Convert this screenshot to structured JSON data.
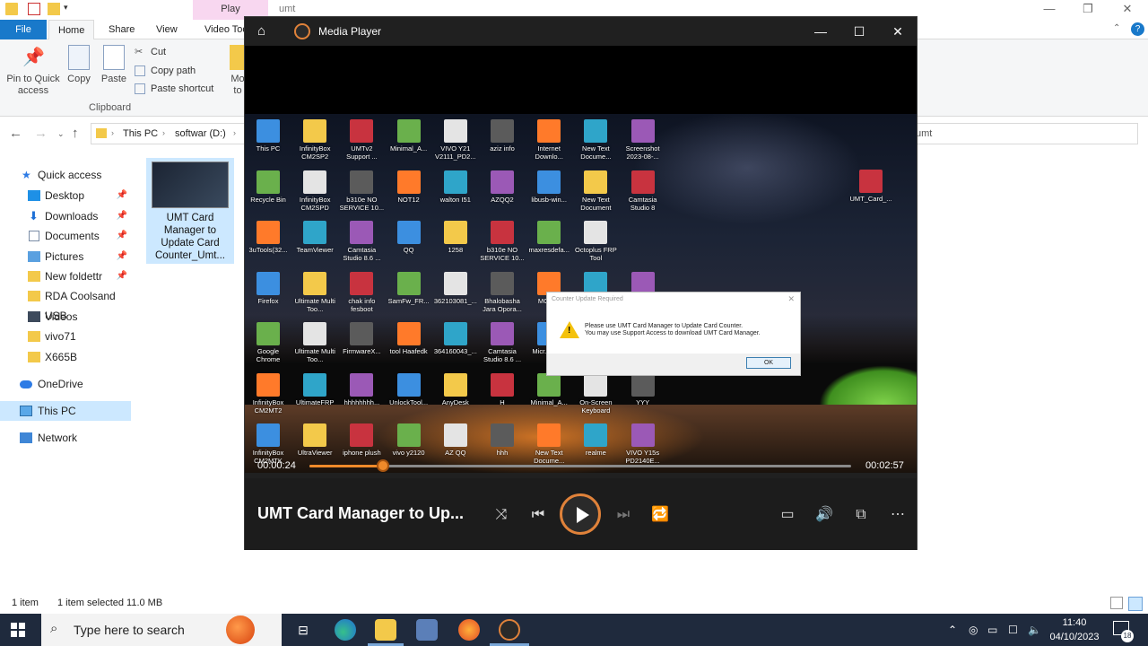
{
  "explorer": {
    "window_title": "umt",
    "context_tab": "Play",
    "tabs": [
      "File",
      "Home",
      "Share",
      "View",
      "Video Tools"
    ],
    "ribbon": {
      "pin_label": "Pin to Quick access",
      "copy_label": "Copy",
      "paste_label": "Paste",
      "cut_label": "Cut",
      "copy_path_label": "Copy path",
      "paste_shortcut_label": "Paste shortcut",
      "move_label": "Mo\nto",
      "group_clipboard": "Clipboard"
    },
    "breadcrumb": [
      "This PC",
      "softwar (D:)"
    ],
    "search_text": "umt",
    "nav": {
      "quick_access": "Quick access",
      "items": [
        {
          "label": "Desktop",
          "pinned": true
        },
        {
          "label": "Downloads",
          "pinned": true
        },
        {
          "label": "Documents",
          "pinned": true
        },
        {
          "label": "Pictures",
          "pinned": true
        },
        {
          "label": "New foldettr",
          "pinned": true
        },
        {
          "label": "RDA Coolsand USB",
          "pinned": false
        },
        {
          "label": "Videos",
          "pinned": false
        },
        {
          "label": "vivo71",
          "pinned": false
        },
        {
          "label": "X665B",
          "pinned": false
        }
      ],
      "onedrive": "OneDrive",
      "this_pc": "This PC",
      "network": "Network"
    },
    "file": {
      "name": "UMT Card Manager to Update Card Counter_Umt..."
    },
    "status": {
      "count": "1 item",
      "selected": "1 item selected  11.0 MB"
    }
  },
  "player": {
    "title": "Media Player",
    "current_time": "00:00:24",
    "total_time": "00:02:57",
    "progress": 0.135,
    "now_playing": "UMT Card Manager to Up...",
    "desktop_icons": [
      [
        "This PC",
        "InfinityBox CM2SP2",
        "UMTv2 Support ...",
        "Minimal_A...",
        "VIVO Y21 V2111_PD2...",
        "aziz info",
        "Internet Downlo...",
        "New Text Docume...",
        "Screenshot 2023-08-..."
      ],
      [
        "Recycle Bin",
        "InfinityBox CM2SPD",
        "b310e NO SERVICE 10...",
        "NOT12",
        "walton I51",
        "AZQQ2",
        "libusb-win...",
        "New Text Document",
        "Camtasia Studio 8"
      ],
      [
        "3uTools(32...",
        "TeamViewer",
        "Camtasia Studio 8.6 ...",
        "QQ",
        "1258",
        "b310e NO SERVICE 10...",
        "maxresdefa...",
        "Octoplus FRP Tool",
        ""
      ],
      [
        "Firefox",
        "Ultimate Multi Too...",
        "chak info fesboot",
        "SamFw_FR...",
        "362103081_...",
        "Bhalobasha Jara Opora...",
        "MCT-...",
        "",
        ""
      ],
      [
        "Google Chrome",
        "Ultimate Multi Too...",
        "FirmwareX...",
        "tool Haafedk",
        "364160043_...",
        "Camtasia Studio 8.6 ...",
        "Micr... Ed...",
        "",
        ""
      ],
      [
        "InfinityBox CM2MT2",
        "UltimateFRP",
        "hhhhhhhh...",
        "UnlockTool...",
        "AnyDesk",
        "H",
        "Minimal_A...",
        "On-Screen Keyboard",
        "YYY"
      ],
      [
        "InfinityBox CM2MTK",
        "UltraViewer",
        "iphone plush",
        "vivo y2120",
        "AZ QQ",
        "hhh",
        "New Text Docume...",
        "realme",
        "VIVO Y15s PD2140E..."
      ]
    ],
    "right_icon": "UMT_Card_...",
    "dialog": {
      "title": "Counter Update Required",
      "line1": "Please use UMT Card Manager to Update Card Counter.",
      "line2": "You may use Support Access to download UMT Card Manager.",
      "ok": "OK"
    }
  },
  "taskbar": {
    "search_placeholder": "Type here to search",
    "time": "11:40",
    "date": "04/10/2023",
    "notification_count": "18"
  },
  "colors": {
    "accent": "#1979ca",
    "player_accent": "#f08a2a",
    "selection": "#cce8ff",
    "taskbar": "#1f2a3d"
  }
}
